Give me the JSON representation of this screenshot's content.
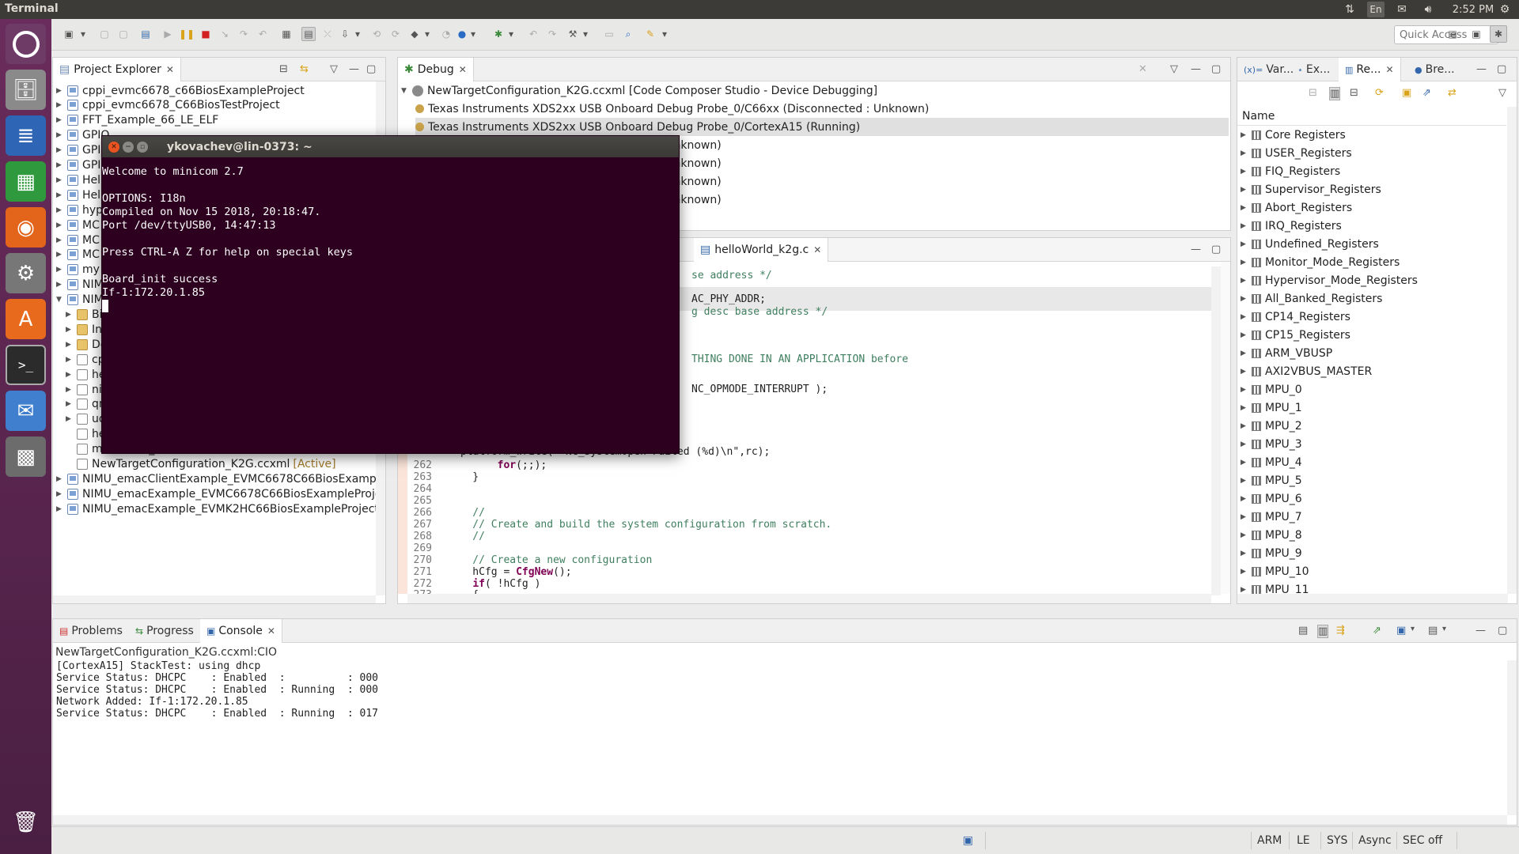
{
  "topbar": {
    "app_title": "Terminal",
    "lang": "En",
    "time": "2:52 PM"
  },
  "toolbar": {
    "quick_access_placeholder": "Quick Access"
  },
  "project_explorer": {
    "title": "Project Explorer",
    "items": [
      {
        "label": "cppi_evmc6678_c66BiosExampleProject",
        "depth": 0,
        "icon": "project",
        "expanded": false
      },
      {
        "label": "cppi_evmc6678_C66BiosTestProject",
        "depth": 0,
        "icon": "project",
        "expanded": false
      },
      {
        "label": "FFT_Example_66_LE_ELF",
        "depth": 0,
        "icon": "project",
        "expanded": false
      },
      {
        "label": "GPIO",
        "depth": 0,
        "icon": "project",
        "expanded": false
      },
      {
        "label": "GPIO",
        "depth": 0,
        "icon": "project",
        "expanded": false
      },
      {
        "label": "GPIO",
        "depth": 0,
        "icon": "project",
        "expanded": false
      },
      {
        "label": "Hell",
        "depth": 0,
        "icon": "project",
        "expanded": false
      },
      {
        "label": "Hell",
        "depth": 0,
        "icon": "project",
        "expanded": false
      },
      {
        "label": "hyp",
        "depth": 0,
        "icon": "project",
        "expanded": false
      },
      {
        "label": "MC",
        "depth": 0,
        "icon": "project",
        "expanded": false
      },
      {
        "label": "MC",
        "depth": 0,
        "icon": "project",
        "expanded": false
      },
      {
        "label": "MC",
        "depth": 0,
        "icon": "project",
        "expanded": false
      },
      {
        "label": "my",
        "depth": 0,
        "icon": "project",
        "expanded": false
      },
      {
        "label": "NIM",
        "depth": 0,
        "icon": "project",
        "expanded": false
      },
      {
        "label": "NIM",
        "depth": 0,
        "icon": "project",
        "expanded": true
      },
      {
        "label": "Bi",
        "depth": 1,
        "icon": "folder",
        "expanded": false
      },
      {
        "label": "Inc",
        "depth": 1,
        "icon": "folder",
        "expanded": false
      },
      {
        "label": "De",
        "depth": 1,
        "icon": "folder",
        "expanded": false
      },
      {
        "label": "cp",
        "depth": 1,
        "icon": "file",
        "expanded": false
      },
      {
        "label": "he",
        "depth": 1,
        "icon": "file",
        "expanded": false
      },
      {
        "label": "nimu_osal.c",
        "depth": 1,
        "icon": "file",
        "expanded": false
      },
      {
        "label": "qmss_device.c",
        "depth": 1,
        "icon": "file",
        "expanded": false
      },
      {
        "label": "udpHello.c",
        "depth": 1,
        "icon": "file",
        "expanded": false
      },
      {
        "label": "helloWorld.cfg",
        "depth": 1,
        "icon": "file",
        "leaf": true
      },
      {
        "label": "macros.ini_initial",
        "depth": 1,
        "icon": "file",
        "leaf": true
      },
      {
        "label": "NewTargetConfiguration_K2G.ccxml",
        "suffix": "[Active]",
        "depth": 1,
        "icon": "file",
        "leaf": true
      },
      {
        "label": "NIMU_emacClientExample_EVMC6678C66BiosExampleP",
        "depth": 0,
        "icon": "project",
        "expanded": false
      },
      {
        "label": "NIMU_emacExample_EVMC6678C66BiosExampleProject",
        "depth": 0,
        "icon": "project",
        "expanded": false
      },
      {
        "label": "NIMU_emacExample_EVMK2HC66BiosExampleProject",
        "depth": 0,
        "icon": "project",
        "expanded": false
      }
    ]
  },
  "debug": {
    "title": "Debug",
    "root": "NewTargetConfiguration_K2G.ccxml [Code Composer Studio - Device Debugging]",
    "items": [
      {
        "label": "Texas Instruments XDS2xx USB Onboard Debug Probe_0/C66xx (Disconnected : Unknown)",
        "selected": false
      },
      {
        "label": "Texas Instruments XDS2xx USB Onboard Debug Probe_0/CortexA15 (Running)",
        "selected": true
      },
      {
        "label": "ug Probe_0/ICSS_0_PRU_0 (Disconnected : Unknown)",
        "selected": false
      },
      {
        "label": "ug Probe_0/ICSS_0_PRU_1 (Disconnected : Unknown)",
        "selected": false
      },
      {
        "label": "ug Probe_0/ICSS_1_PRU_0 (Disconnected : Unknown)",
        "selected": false
      },
      {
        "label": "ug Probe_0/ICSS_1_PRU_1 (Disconnected : Unknown)",
        "selected": false
      }
    ]
  },
  "editor": {
    "tab": "helloWorld_k2g.c",
    "lines": [
      {
        "no": "",
        "segments": [
          {
            "t": "se address */",
            "c": "cm"
          }
        ],
        "offset": 0
      },
      {
        "no": "",
        "segments": [
          {
            "t": "AC_PHY_ADDR;",
            "c": ""
          }
        ],
        "offset": 0,
        "highlight": true
      },
      {
        "no": "",
        "segments": [
          {
            "t": "g desc base address */",
            "c": "cm"
          }
        ],
        "offset": 0
      },
      {
        "no": "",
        "segments": [
          {
            "t": "THING DONE IN AN APPLICATION before",
            "c": "cm"
          }
        ],
        "offset": 0
      },
      {
        "no": "",
        "segments": [
          {
            "t": "NC_OPMODE_INTERRUPT );",
            "c": ""
          }
        ],
        "offset": 0
      },
      {
        "no": "262",
        "segments": [
          {
            "t": "        ",
            "c": ""
          },
          {
            "t": "for",
            "c": "kw"
          },
          {
            "t": "(;;);",
            "c": ""
          }
        ]
      },
      {
        "no": "263",
        "segments": [
          {
            "t": "    }",
            "c": ""
          }
        ]
      },
      {
        "no": "264",
        "segments": []
      },
      {
        "no": "265",
        "segments": []
      },
      {
        "no": "266",
        "segments": [
          {
            "t": "    //",
            "c": "cm"
          }
        ]
      },
      {
        "no": "267",
        "segments": [
          {
            "t": "    // Create and build the system configuration from scratch.",
            "c": "cm"
          }
        ]
      },
      {
        "no": "268",
        "segments": [
          {
            "t": "    //",
            "c": "cm"
          }
        ]
      },
      {
        "no": "269",
        "segments": []
      },
      {
        "no": "270",
        "segments": [
          {
            "t": "    // Create a new configuration",
            "c": "cm"
          }
        ]
      },
      {
        "no": "271",
        "segments": [
          {
            "t": "    hCfg = ",
            "c": ""
          },
          {
            "t": "CfgNew",
            "c": "kw"
          },
          {
            "t": "();",
            "c": ""
          }
        ]
      },
      {
        "no": "272",
        "segments": [
          {
            "t": "    ",
            "c": ""
          },
          {
            "t": "if",
            "c": "kw"
          },
          {
            "t": "( !hCfg )",
            "c": ""
          }
        ]
      },
      {
        "no": "273",
        "segments": [
          {
            "t": "    {",
            "c": ""
          }
        ]
      }
    ],
    "partial_line": "platform_write( \"NC_SystemOpen Failed (%d)\\n\",rc);"
  },
  "registers": {
    "tabs": [
      "Var...",
      "Ex...",
      "Re...",
      "Bre..."
    ],
    "column": "Name",
    "items": [
      "Core Registers",
      "USER_Registers",
      "FIQ_Registers",
      "Supervisor_Registers",
      "Abort_Registers",
      "IRQ_Registers",
      "Undefined_Registers",
      "Monitor_Mode_Registers",
      "Hypervisor_Mode_Registers",
      "All_Banked_Registers",
      "CP14_Registers",
      "CP15_Registers",
      "ARM_VBUSP",
      "AXI2VBUS_MASTER",
      "MPU_0",
      "MPU_1",
      "MPU_2",
      "MPU_3",
      "MPU_4",
      "MPU_5",
      "MPU_6",
      "MPU_7",
      "MPU_8",
      "MPU_9",
      "MPU_10",
      "MPU_11"
    ]
  },
  "console": {
    "tabs": [
      "Problems",
      "Progress",
      "Console"
    ],
    "header": "NewTargetConfiguration_K2G.ccxml:CIO",
    "lines": [
      "[CortexA15] StackTest: using dhcp",
      "Service Status: DHCPC    : Enabled  :          : 000",
      "Service Status: DHCPC    : Enabled  : Running  : 000",
      "Network Added: If-1:172.20.1.85",
      "Service Status: DHCPC    : Enabled  : Running  : 017"
    ]
  },
  "terminal": {
    "title": "ykovachev@lin-0373: ~",
    "lines": [
      "Welcome to minicom 2.7",
      "",
      "OPTIONS: I18n",
      "Compiled on Nov 15 2018, 20:18:47.",
      "Port /dev/ttyUSB0, 14:47:13",
      "",
      "Press CTRL-A Z for help on special keys",
      "",
      "Board_init success",
      "If-1:172.20.1.85"
    ]
  },
  "statusbar": {
    "items": [
      "ARM",
      "LE",
      "SYS",
      "Async",
      "SEC off"
    ]
  }
}
